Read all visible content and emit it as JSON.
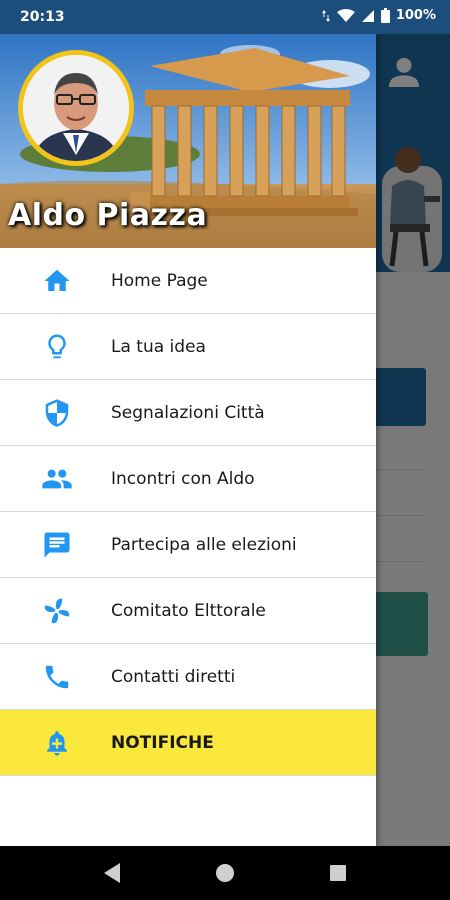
{
  "status_bar": {
    "time": "20:13",
    "battery": "100%"
  },
  "drawer": {
    "user_name": "Aldo Piazza",
    "menu_items": [
      {
        "label": "Home Page",
        "icon": "home-icon"
      },
      {
        "label": "La tua idea",
        "icon": "lightbulb-icon"
      },
      {
        "label": "Segnalazioni Città",
        "icon": "shield-icon"
      },
      {
        "label": "Incontri con Aldo",
        "icon": "people-icon"
      },
      {
        "label": "Partecipa alle elezioni",
        "icon": "chat-icon"
      },
      {
        "label": "Comitato Elttorale",
        "icon": "pinwheel-icon"
      },
      {
        "label": "Contatti diretti",
        "icon": "phone-icon"
      },
      {
        "label": "NOTIFICHE",
        "icon": "bell-add-icon"
      }
    ]
  },
  "colors": {
    "accent": "#2196f3",
    "highlight": "#fbe83d",
    "status_bar": "#1d4d7a",
    "avatar_ring": "#f0c419"
  },
  "nav_bar": {
    "buttons": [
      "back-icon",
      "home-circle-icon",
      "recents-icon"
    ]
  }
}
